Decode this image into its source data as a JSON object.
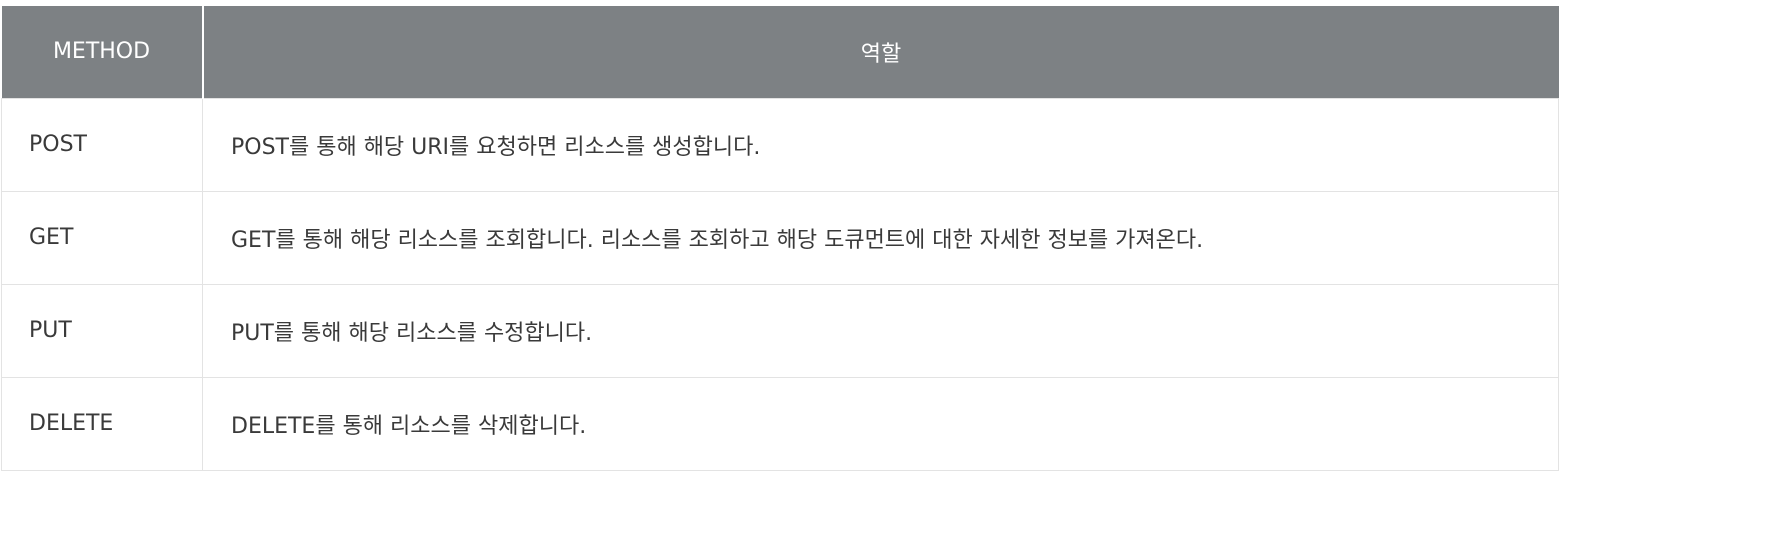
{
  "table": {
    "headers": [
      "METHOD",
      "역할"
    ],
    "rows": [
      {
        "method": "POST",
        "role": "POST를 통해 해당 URI를 요청하면 리소스를 생성합니다."
      },
      {
        "method": "GET",
        "role": "GET를 통해 해당 리소스를 조회합니다. 리소스를 조회하고 해당 도큐먼트에 대한 자세한 정보를 가져온다."
      },
      {
        "method": "PUT",
        "role": "PUT를 통해 해당 리소스를 수정합니다."
      },
      {
        "method": "DELETE",
        "role": "DELETE를 통해 리소스를 삭제합니다."
      }
    ]
  },
  "colors": {
    "header_bg": "#7d8184",
    "header_text": "#ffffff",
    "body_text": "#3a3a3a",
    "border": "#e3e3e3"
  }
}
